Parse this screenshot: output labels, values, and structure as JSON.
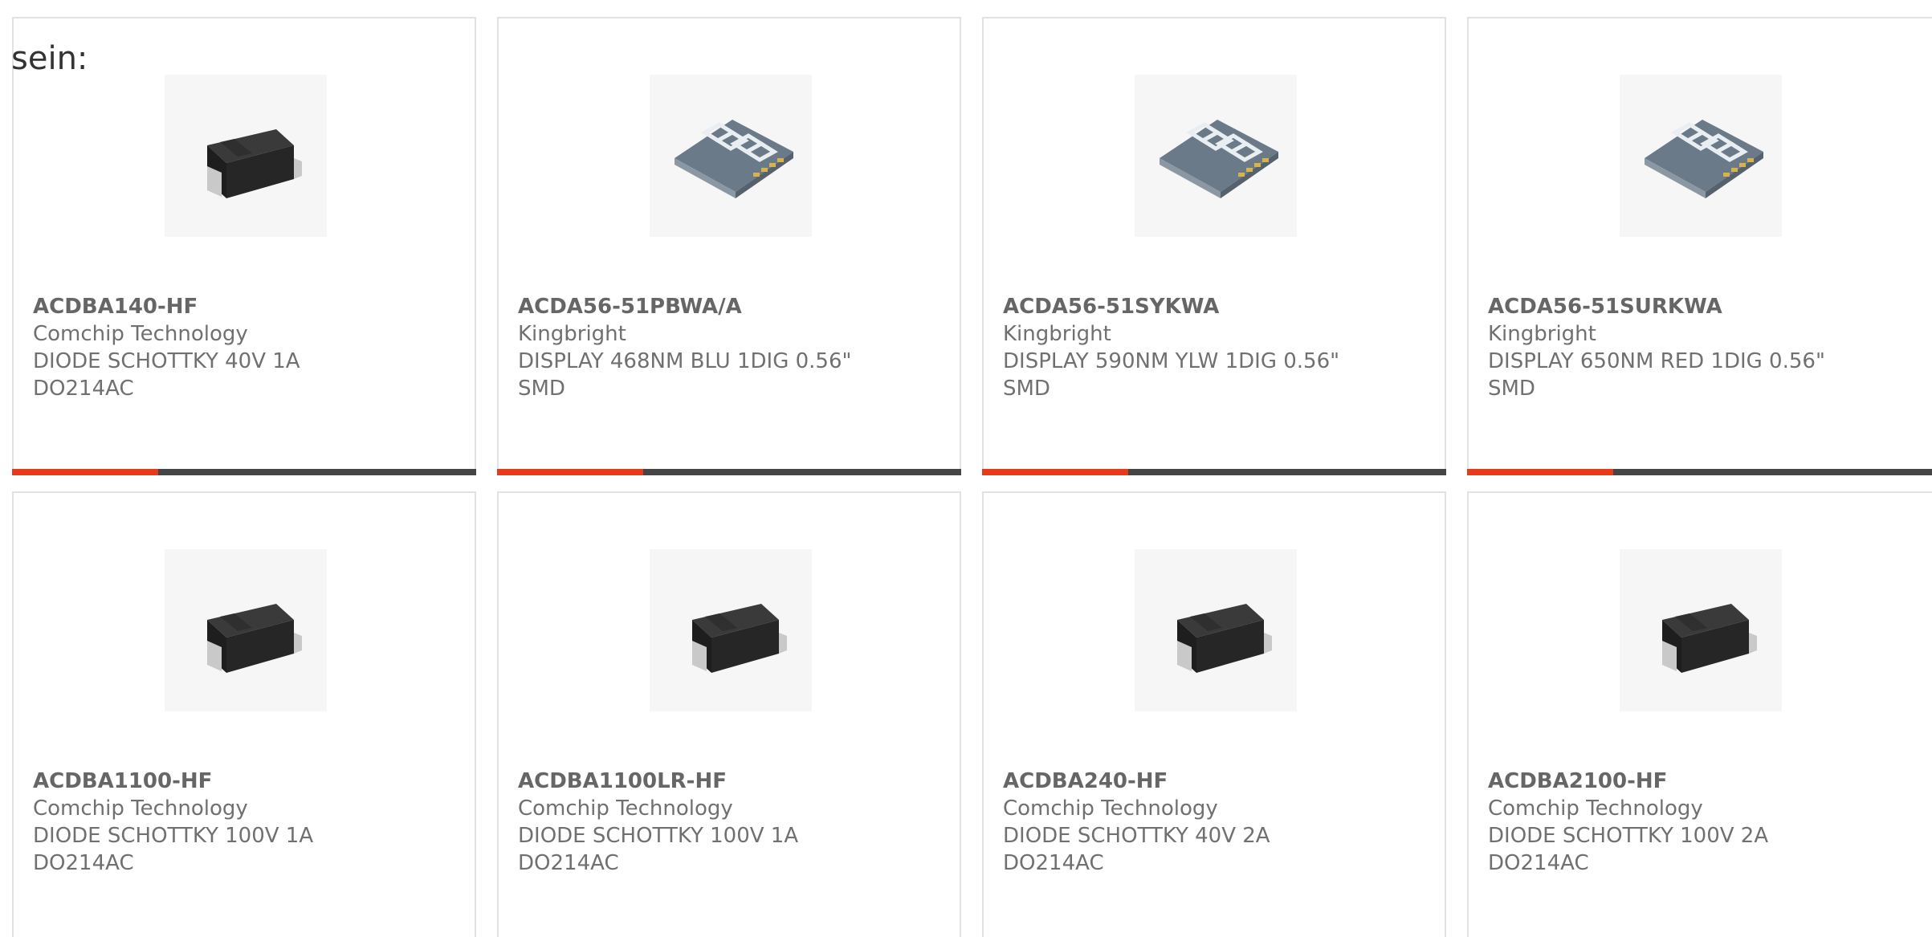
{
  "intro_text": "sein:",
  "accent_color": "#e8391a",
  "bar_color": "#454545",
  "cards": [
    {
      "part": "ACDBA140-HF",
      "manufacturer": "Comchip Technology",
      "description": "DIODE SCHOTTKY 40V 1A\nDO214AC",
      "icon": "diode-smd-icon"
    },
    {
      "part": "ACDA56-51PBWA/A",
      "manufacturer": "Kingbright",
      "description": "DISPLAY 468NM BLU 1DIG 0.56\"\nSMD",
      "icon": "seven-segment-display-icon"
    },
    {
      "part": "ACDA56-51SYKWA",
      "manufacturer": "Kingbright",
      "description": "DISPLAY 590NM YLW 1DIG 0.56\"\nSMD",
      "icon": "seven-segment-display-icon"
    },
    {
      "part": "ACDA56-51SURKWA",
      "manufacturer": "Kingbright",
      "description": "DISPLAY 650NM RED 1DIG 0.56\"\nSMD",
      "icon": "seven-segment-display-icon"
    },
    {
      "part": "ACDBA1100-HF",
      "manufacturer": "Comchip Technology",
      "description": "DIODE SCHOTTKY 100V 1A\nDO214AC",
      "icon": "diode-smd-icon"
    },
    {
      "part": "ACDBA1100LR-HF",
      "manufacturer": "Comchip Technology",
      "description": "DIODE SCHOTTKY 100V 1A\nDO214AC",
      "icon": "diode-smd-icon"
    },
    {
      "part": "ACDBA240-HF",
      "manufacturer": "Comchip Technology",
      "description": "DIODE SCHOTTKY 40V 2A\nDO214AC",
      "icon": "diode-smd-icon"
    },
    {
      "part": "ACDBA2100-HF",
      "manufacturer": "Comchip Technology",
      "description": "DIODE SCHOTTKY 100V 2A\nDO214AC",
      "icon": "diode-smd-icon"
    }
  ]
}
